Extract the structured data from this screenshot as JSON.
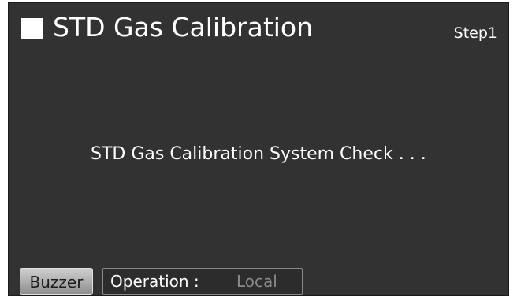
{
  "header": {
    "title": "STD Gas Calibration",
    "step": "Step1"
  },
  "main": {
    "message": "STD Gas Calibration System Check . . ."
  },
  "footer": {
    "buzzer_label": "Buzzer",
    "operation_label": "Operation :",
    "operation_value": "Local"
  },
  "colors": {
    "screen_background": "#323232",
    "text": "#ffffff",
    "button": "#b0b0b0",
    "disabled_text": "#8a8a8a"
  }
}
